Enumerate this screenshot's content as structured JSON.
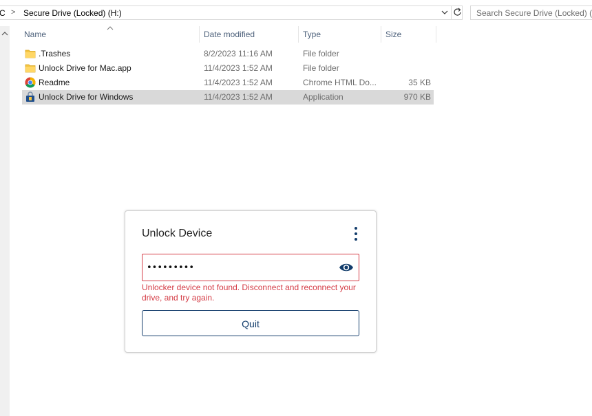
{
  "address": {
    "crumb_pc": "PC",
    "separator": ">",
    "crumb_drive": "Secure Drive (Locked) (H:)"
  },
  "search": {
    "placeholder": "Search Secure Drive (Locked) (H:)"
  },
  "columns": {
    "name": "Name",
    "date": "Date modified",
    "type": "Type",
    "size": "Size"
  },
  "files": [
    {
      "name": ".Trashes",
      "date": "8/2/2023 11:16 AM",
      "type": "File folder",
      "size": "",
      "icon": "folder-icon",
      "selected": false
    },
    {
      "name": "Unlock Drive for Mac.app",
      "date": "11/4/2023 1:52 AM",
      "type": "File folder",
      "size": "",
      "icon": "folder-icon",
      "selected": false
    },
    {
      "name": "Readme",
      "date": "11/4/2023 1:52 AM",
      "type": "Chrome HTML Do...",
      "size": "35 KB",
      "icon": "chrome-icon",
      "selected": false
    },
    {
      "name": "Unlock Drive for Windows",
      "date": "11/4/2023 1:52 AM",
      "type": "Application",
      "size": "970 KB",
      "icon": "application-lock-icon",
      "selected": true
    }
  ],
  "dialog": {
    "title": "Unlock Device",
    "password_value": "•••••••••",
    "error": "Unlocker device not found. Disconnect and reconnect your drive, and try again.",
    "quit_label": "Quit"
  },
  "colors": {
    "error_red": "#d43b45",
    "navy": "#123c6b",
    "selection": "#d9d9d9",
    "header_text": "#4c607a",
    "folder_yellow": "#f4c542"
  }
}
